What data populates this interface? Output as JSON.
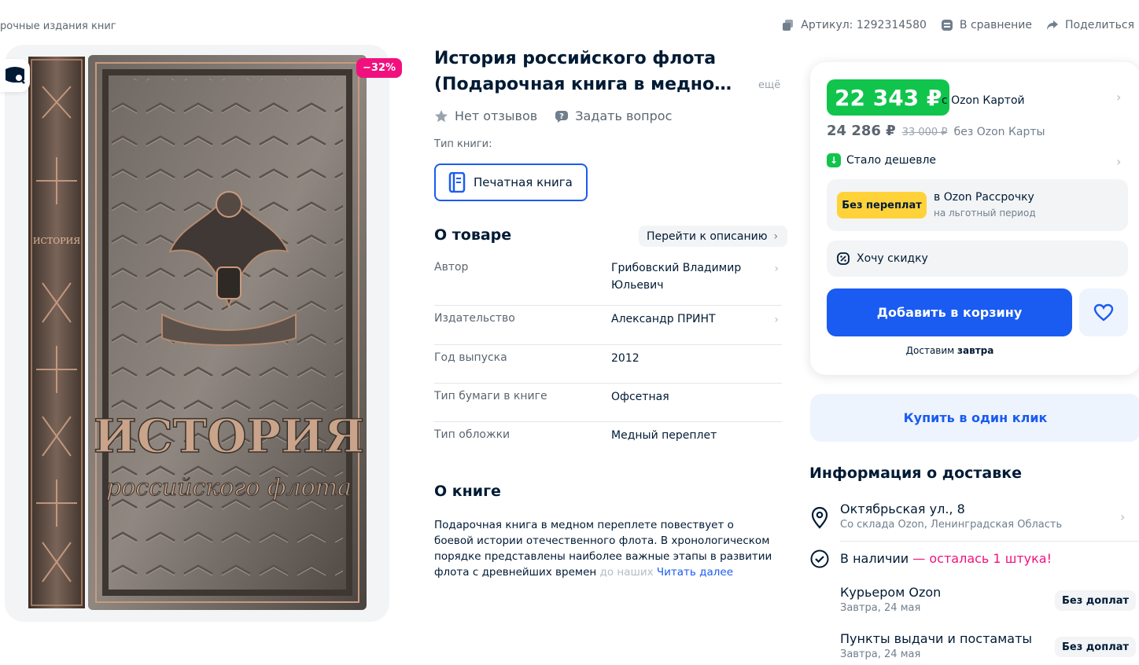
{
  "breadcrumb": "рочные издания книг",
  "top_meta": {
    "article": "Артикул: 1292314580",
    "compare": "В сравнение",
    "share": "Поделиться"
  },
  "gallery": {
    "discount": "−32%",
    "book_cover_lettering": [
      "ИСТОРИЯ",
      "российского флота"
    ]
  },
  "product": {
    "title_line1": "История российского флота",
    "title_line2": "(Подарочная книга в медном...",
    "more": "ещё",
    "reviews": "Нет отзывов",
    "ask": "Задать вопрос",
    "type_label": "Тип книги:",
    "type_value": "Печатная книга"
  },
  "about": {
    "heading": "О товаре",
    "goto_desc": "Перейти к описанию",
    "props": [
      {
        "key": "Автор",
        "value": "Грибовский Владимир Юльевич"
      },
      {
        "key": "Издательство",
        "value": "Александр ПРИНТ"
      },
      {
        "key": "Год выпуска",
        "value": "2012"
      },
      {
        "key": "Тип бумаги в книге",
        "value": "Офсетная"
      },
      {
        "key": "Тип обложки",
        "value": "Медный переплет"
      }
    ]
  },
  "book_desc": {
    "heading": "О книге",
    "text": "Подарочная книга в медном переплете повествует о боевой истории отечественного флота. В хронологическом порядке представлены наиболее важные этапы в развитии флота с древнейших времен",
    "fade": " до наших ",
    "read_more": "Читать далее"
  },
  "price": {
    "card_price": "22 343 ₽",
    "card_label": "с Ozon Картой",
    "regular_price": "24 286 ₽",
    "old_price": "33 000 ₽",
    "regular_label": "без Ozon Карты",
    "cheaper": "Стало дешевле",
    "installment_badge": "Без переплат",
    "installment_title": "в Ozon Рассрочку",
    "installment_sub": "на льготный период",
    "want_discount": "Хочу скидку",
    "add_to_cart": "Добавить в корзину",
    "deliver_prefix": "Доставим ",
    "deliver_when": "завтра",
    "one_click": "Купить в один клик"
  },
  "delivery": {
    "heading": "Информация о доставке",
    "address": "Октябрьская ул., 8",
    "warehouse": "Со склада Ozon, Ленинградская Область",
    "stock": "В наличии",
    "stock_note": " — осталась 1 штука!",
    "options": [
      {
        "name": "Курьером Ozon",
        "date": "Завтра, 24 мая",
        "badge": "Без доплат"
      },
      {
        "name": "Пункты выдачи и постаматы",
        "date": "Завтра, 24 мая",
        "badge": "Без доплат"
      }
    ]
  },
  "colors": {
    "accent": "#1a5bf1",
    "card_price": "#10c44c",
    "discount": "#f1117e",
    "installment": "#ffd23a"
  }
}
